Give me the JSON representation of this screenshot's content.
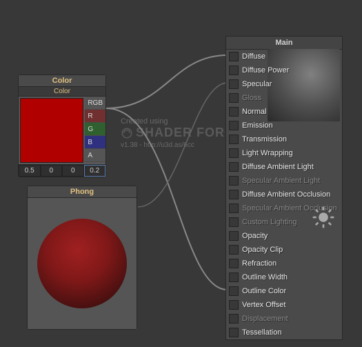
{
  "watermark": {
    "created": "Created using",
    "brand": "SHADER FORGE",
    "version": "v1.38 - http://u3d.as/6cc"
  },
  "color_node": {
    "title": "Color",
    "subtitle": "Color",
    "swatch_hex": "#b00000",
    "outputs": {
      "rgb": "RGB",
      "r": "R",
      "g": "G",
      "b": "B",
      "a": "A"
    },
    "values": {
      "r": "0.5",
      "g": "0",
      "b": "0",
      "a": "0.2"
    }
  },
  "phong_node": {
    "title": "Phong"
  },
  "main_panel": {
    "title": "Main",
    "props": [
      {
        "label": "Diffuse",
        "enabled": true
      },
      {
        "label": "Diffuse Power",
        "enabled": true
      },
      {
        "label": "Specular",
        "enabled": true
      },
      {
        "label": "Gloss",
        "enabled": false
      },
      {
        "label": "Normal",
        "enabled": true
      },
      {
        "label": "Emission",
        "enabled": true
      },
      {
        "label": "Transmission",
        "enabled": true
      },
      {
        "label": "Light Wrapping",
        "enabled": true
      },
      {
        "label": "Diffuse Ambient Light",
        "enabled": true
      },
      {
        "label": "Specular Ambient Light",
        "enabled": false
      },
      {
        "label": "Diffuse Ambient Occlusion",
        "enabled": true
      },
      {
        "label": "Specular Ambient Occlusion",
        "enabled": false
      },
      {
        "label": "Custom Lighting",
        "enabled": false
      },
      {
        "label": "Opacity",
        "enabled": true
      },
      {
        "label": "Opacity Clip",
        "enabled": true
      },
      {
        "label": "Refraction",
        "enabled": true
      },
      {
        "label": "Outline Width",
        "enabled": true
      },
      {
        "label": "Outline Color",
        "enabled": true
      },
      {
        "label": "Vertex Offset",
        "enabled": true
      },
      {
        "label": "Displacement",
        "enabled": false
      },
      {
        "label": "Tessellation",
        "enabled": true
      }
    ]
  }
}
